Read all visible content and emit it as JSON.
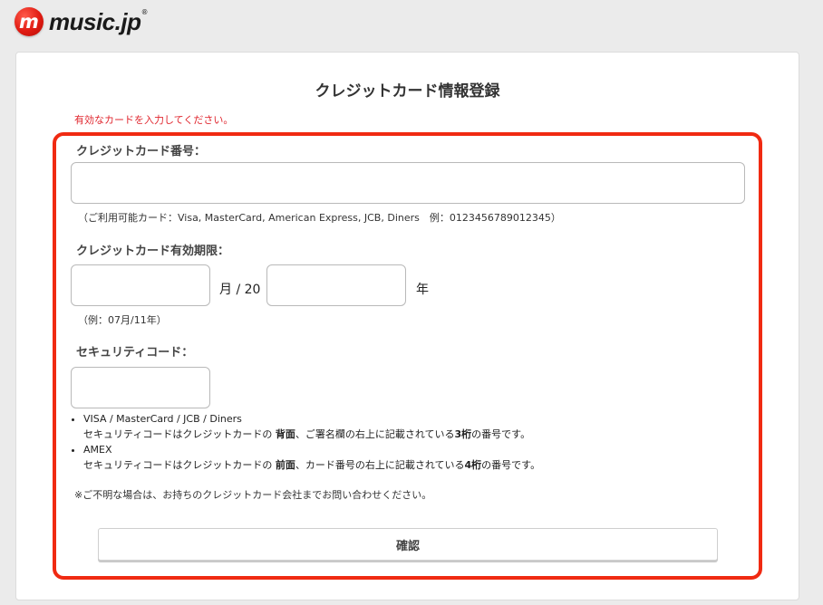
{
  "header": {
    "logo_mark": "m",
    "logo_text": "music.jp",
    "logo_reg": "®"
  },
  "page": {
    "title": "クレジットカード情報登録",
    "error": "有効なカードを入力してください。"
  },
  "card_number": {
    "label": "クレジットカード番号：",
    "value": "",
    "note": "（ご利用可能カード：Visa, MasterCard, American Express, JCB, Diners　例：0123456789012345）"
  },
  "expiry": {
    "label": "クレジットカード有効期限：",
    "month_value": "",
    "month_sep": "月 / 20",
    "year_value": "",
    "year_sep": "年",
    "note": "（例：07月/11年）"
  },
  "security": {
    "label": "セキュリティコード：",
    "value": "",
    "items": [
      {
        "brand": "VISA / MasterCard / JCB / Diners",
        "desc_pre": "セキュリティコードはクレジットカードの ",
        "desc_b1": "背面",
        "desc_mid": "、ご署名欄の右上に記載されている",
        "desc_b2": "3桁",
        "desc_post": "の番号です。"
      },
      {
        "brand": "AMEX",
        "desc_pre": "セキュリティコードはクレジットカードの ",
        "desc_b1": "前面",
        "desc_mid": "、カード番号の右上に記載されている",
        "desc_b2": "4桁",
        "desc_post": "の番号です。"
      }
    ],
    "footnote": "※ご不明な場合は、お持ちのクレジットカード会社までお問い合わせください。"
  },
  "confirm_label": "確認",
  "colors": {
    "accent_red": "#f02a12",
    "error_red": "#e0262e",
    "background": "#ebebeb"
  }
}
